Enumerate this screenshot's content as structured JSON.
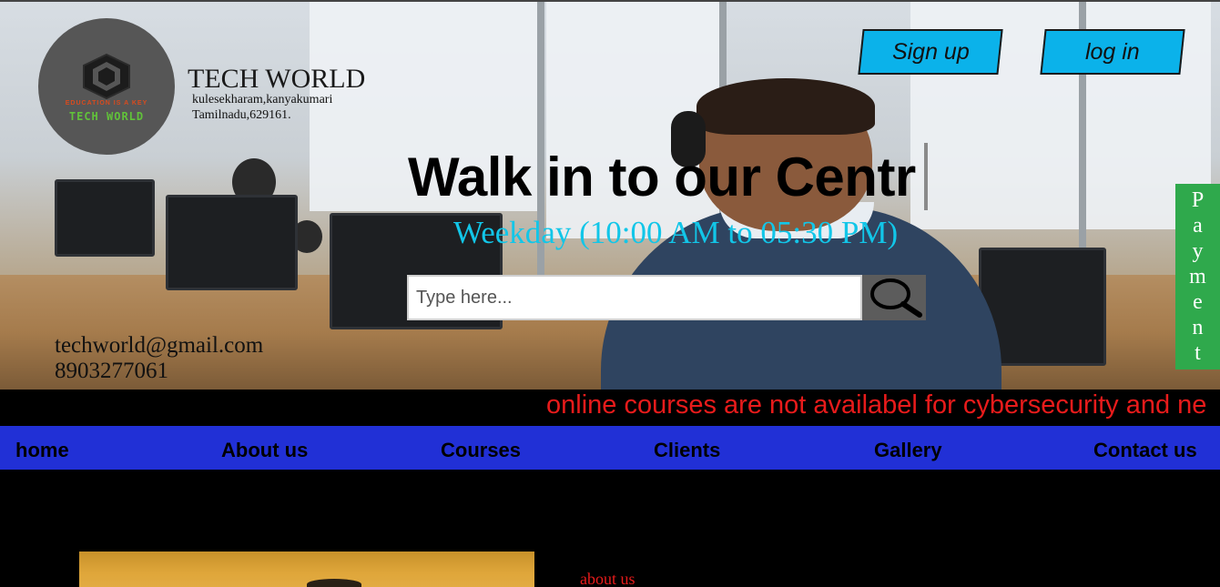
{
  "brand": {
    "logo_text": "TECH WORLD",
    "logo_ring": "EDUCATION IS A KEY",
    "name": "TECH WORLD",
    "address_line1": "kulesekharam,kanyakumari",
    "address_line2": "Tamilnadu,629161."
  },
  "auth": {
    "signup_label": "Sign up",
    "login_label": "log in"
  },
  "hero": {
    "headline": "Walk in to our Centr",
    "hours": "Weekday (10:00 AM to 05:30 PM)"
  },
  "search": {
    "placeholder": "Type here...",
    "icon": "search-icon"
  },
  "contact": {
    "email": "techworld@gmail.com",
    "phone": "8903277061"
  },
  "payment_letters": [
    "P",
    "a",
    "y",
    "m",
    "e",
    "n",
    "t"
  ],
  "marquee": {
    "text": "online courses are not availabel for cybersecurity and ne"
  },
  "nav": {
    "items": [
      "home",
      "About us",
      "Courses",
      "Clients",
      "Gallery",
      "Contact us"
    ]
  },
  "about": {
    "link": "about us"
  },
  "colors": {
    "button": "#0bb2ea",
    "nav": "#2130d6",
    "payment": "#2fa94c",
    "marquee_text": "#e81b1b",
    "hours_text": "#12c6e8"
  }
}
